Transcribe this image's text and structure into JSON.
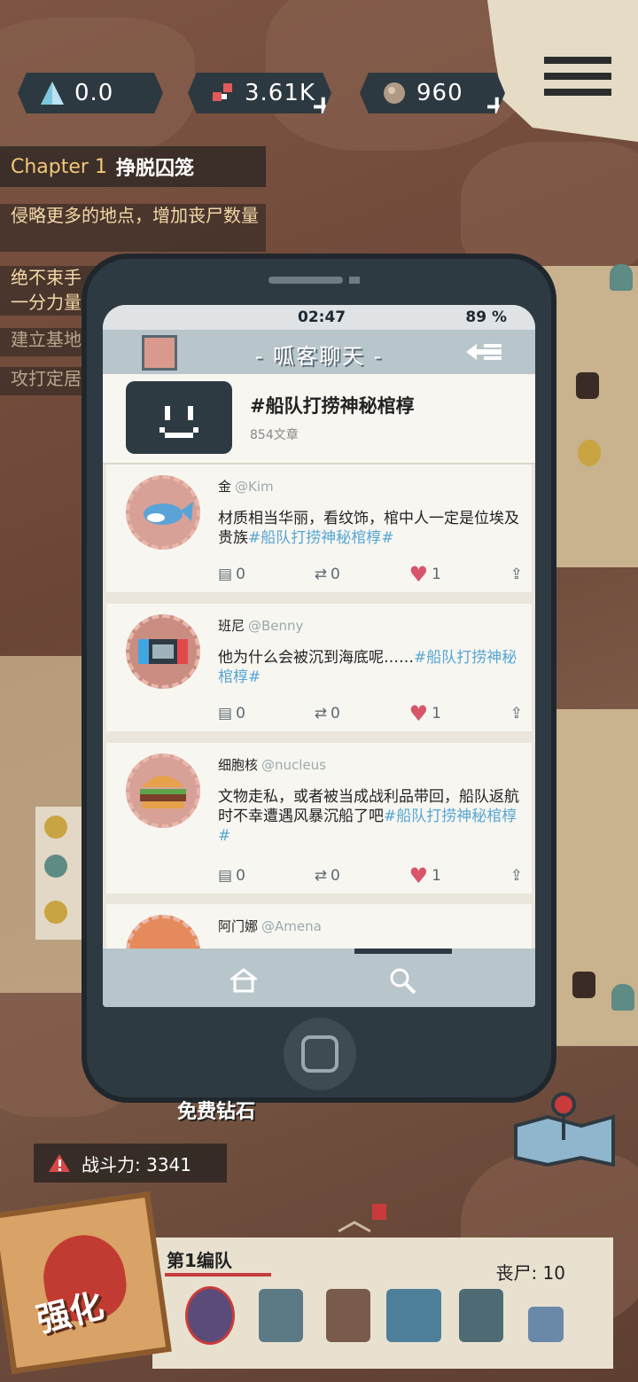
{
  "hud": {
    "resources": [
      {
        "icon": "triangle-crystal-icon",
        "value": "0.0"
      },
      {
        "icon": "gem-cluster-icon",
        "value": "3.61K",
        "plus": "+"
      },
      {
        "icon": "stone-orb-icon",
        "value": "960",
        "plus": "+"
      }
    ],
    "menu_icon": "hamburger-menu-icon"
  },
  "chapter": {
    "label": "Chapter 1",
    "title": "挣脱囚笼"
  },
  "quests": [
    "侵略更多的地点，增加丧尸数量",
    "绝不束手",
    "一分力量",
    "建立基地",
    "攻打定居"
  ],
  "phone": {
    "time": "02:47",
    "battery": "89 %",
    "app_title": "- 呱客聊天 -",
    "topic": {
      "name": "#船队打捞神秘棺椁",
      "count": "854文章"
    },
    "posts": [
      {
        "avatar": "dolphin-avatar-icon",
        "name": "金",
        "handle": "@Kim",
        "text": "材质相当华丽，看纹饰，棺中人一定是位埃及贵族",
        "tag": "#船队打捞神秘棺椁#",
        "comments": "0",
        "reposts": "0",
        "likes": "1"
      },
      {
        "avatar": "game-console-avatar-icon",
        "name": "班尼",
        "handle": "@Benny",
        "text": "他为什么会被沉到海底呢……",
        "tag": "#船队打捞神秘棺椁#",
        "comments": "0",
        "reposts": "0",
        "likes": "1"
      },
      {
        "avatar": "burger-avatar-icon",
        "name": "细胞核",
        "handle": "@nucleus",
        "text": "文物走私，或者被当成战利品带回，船队返航时不幸遭遇风暴沉船了吧",
        "tag": "#船队打捞神秘棺椁#",
        "comments": "0",
        "reposts": "0",
        "likes": "1"
      },
      {
        "avatar": "sun-avatar-icon",
        "name": "阿门娜",
        "handle": "@Amena"
      }
    ]
  },
  "bottom": {
    "free_text": "免费钻石",
    "power_label": "战斗力: 3341",
    "team_name": "第1编队",
    "zombie_count": "丧尸: 10",
    "strengthen": "强化"
  }
}
